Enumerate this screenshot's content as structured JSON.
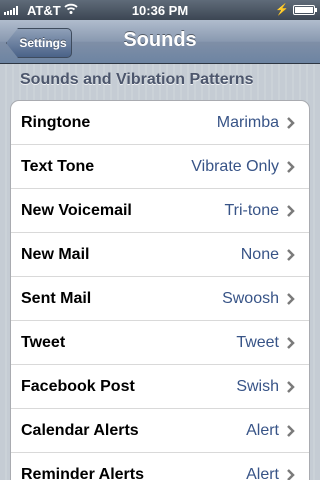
{
  "status_bar": {
    "carrier": "AT&T",
    "time": "10:36 PM",
    "icons": [
      "signal-icon",
      "wifi-icon",
      "charging-bolt-icon",
      "battery-icon"
    ]
  },
  "nav": {
    "back_label": "Settings",
    "title": "Sounds"
  },
  "section": {
    "header": "Sounds and Vibration Patterns"
  },
  "rows": [
    {
      "label": "Ringtone",
      "value": "Marimba"
    },
    {
      "label": "Text Tone",
      "value": "Vibrate Only"
    },
    {
      "label": "New Voicemail",
      "value": "Tri-tone"
    },
    {
      "label": "New Mail",
      "value": "None"
    },
    {
      "label": "Sent Mail",
      "value": "Swoosh"
    },
    {
      "label": "Tweet",
      "value": "Tweet"
    },
    {
      "label": "Facebook Post",
      "value": "Swish"
    },
    {
      "label": "Calendar Alerts",
      "value": "Alert"
    },
    {
      "label": "Reminder Alerts",
      "value": "Alert"
    }
  ],
  "colors": {
    "value_text": "#385487",
    "nav_bar": "#6d84a2",
    "background": "#c5ccd4"
  }
}
